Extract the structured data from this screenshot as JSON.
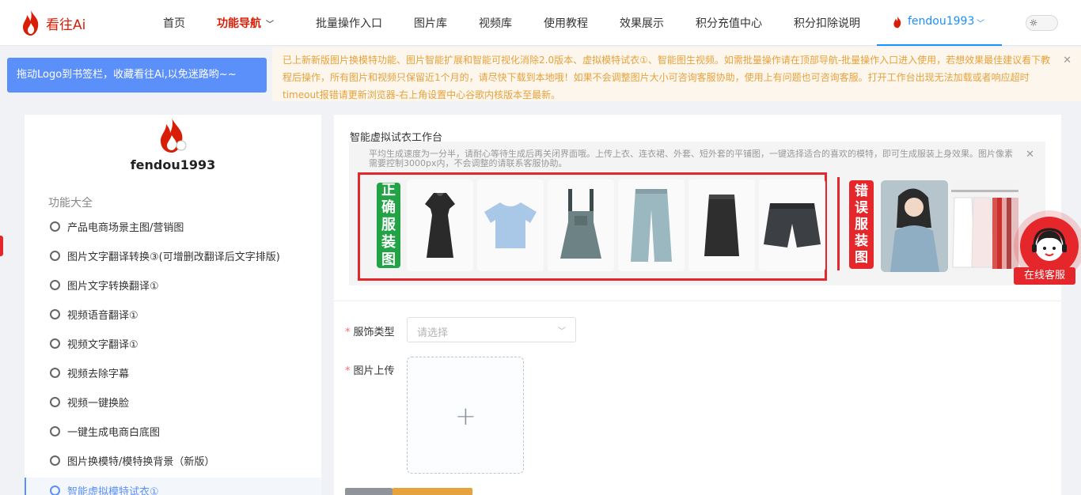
{
  "brand": {
    "name": "看往Ai",
    "accent": "#d81e06"
  },
  "nav": {
    "items": [
      {
        "label": "首页"
      },
      {
        "label": "功能导航"
      },
      {
        "label": "批量操作入口"
      },
      {
        "label": "图片库"
      },
      {
        "label": "视频库"
      },
      {
        "label": "使用教程"
      },
      {
        "label": "效果展示"
      },
      {
        "label": "积分充值中心"
      },
      {
        "label": "积分扣除说明"
      }
    ],
    "user": "fendou1993"
  },
  "bookmark_banner": "拖动Logo到书签栏，收藏看往Ai,以免迷路哟~~",
  "notice": "已上新新版图片换模特功能、图片智能扩展和智能可视化消除2.0版本、虚拟模特试衣①、智能图生视频。如需批量操作请在顶部导航-批量操作入口进入使用，若想效果最佳建议看下教程后操作，所有图片和视频只保留近1个月的，请尽快下载到本地哦！如果不会调整图片大小可咨询客服协助，使用上有问题也可咨询客服。打开工作台出现无法加载或者响应超时timeout报错请更新浏览器-右上角设置中心谷歌内核版本至最新。",
  "sidebar": {
    "username": "fendou1993",
    "section_title": "功能大全",
    "items": [
      {
        "label": "产品电商场景主图/营销图"
      },
      {
        "label": "图片文字翻译转换③(可增删改翻译后文字排版)"
      },
      {
        "label": "图片文字转换翻译①"
      },
      {
        "label": "视频语音翻译①"
      },
      {
        "label": "视频文字翻译①"
      },
      {
        "label": "视频去除字幕"
      },
      {
        "label": "视频一键换脸"
      },
      {
        "label": "一键生成电商白底图"
      },
      {
        "label": "图片换模特/模特换背景（新版）"
      },
      {
        "label": "智能虚拟模特试衣①"
      }
    ]
  },
  "workspace": {
    "title": "智能虚拟试衣工作台",
    "tips": "平均生成速度为一分半，请耐心等待生成后再关闭界面哦。上传上衣、连衣裙、外套、短外套的平铺图，一键选择适合的喜欢的模特，即可生成服装上身效果。图片像素需要控制3000px内，不会调整的请联系客服协助。",
    "correct_label": [
      "正",
      "确",
      "服",
      "装",
      "图"
    ],
    "wrong_label": [
      "错",
      "误",
      "服",
      "装",
      "图"
    ],
    "form": {
      "clothing_type_label": "服饰类型",
      "clothing_type_placeholder": "请选择",
      "upload_label": "图片上传",
      "upload_icon": "plus-icon"
    }
  },
  "service": {
    "label": "在线客服"
  }
}
